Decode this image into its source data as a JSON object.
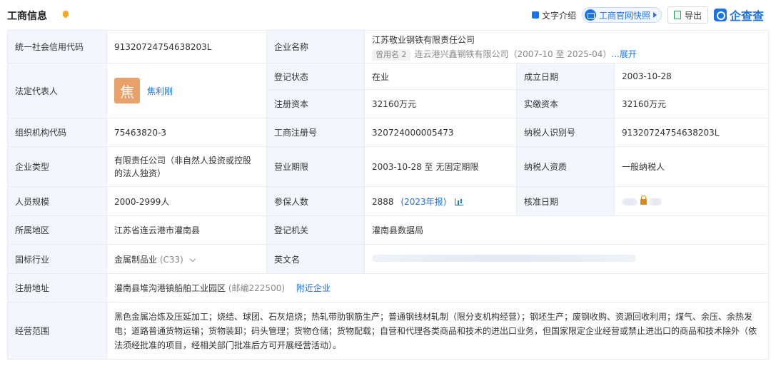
{
  "header": {
    "title": "工商信息",
    "text_intro": "文字介绍",
    "snapshot": "工商官网快照",
    "export": "导出",
    "logo": "企查查"
  },
  "rows": {
    "credit_code_label": "统一社会信用代码",
    "credit_code": "91320724754638203L",
    "company_name_label": "企业名称",
    "company_name": "江苏敬业钢铁有限责任公司",
    "former_tag": "曾用名 2",
    "former_name": "连云港兴鑫钢铁有限公司（2007-10 至 2025-04）",
    "expand": "...展开",
    "legal_label": "法定代表人",
    "legal_avatar": "焦",
    "legal_name": "焦利刚",
    "reg_status_label": "登记状态",
    "reg_status": "在业",
    "founded_label": "成立日期",
    "founded": "2003-10-28",
    "reg_capital_label": "注册资本",
    "reg_capital": "32160万元",
    "paid_capital_label": "实缴资本",
    "paid_capital": "32160万元",
    "org_code_label": "组织机构代码",
    "org_code": "75463820-3",
    "biz_reg_label": "工商注册号",
    "biz_reg": "320724000005473",
    "taxpayer_id_label": "纳税人识别号",
    "taxpayer_id": "91320724754638203L",
    "ent_type_label": "企业类型",
    "ent_type": "有限责任公司（非自然人投资或控股的法人独资）",
    "term_label": "营业期限",
    "term": "2003-10-28 至 无固定期限",
    "tax_qual_label": "纳税人资质",
    "tax_qual": "一般纳税人",
    "staff_label": "人员规模",
    "staff": "2000-2999人",
    "insured_label": "参保人数",
    "insured": "2888",
    "insured_year": "(2023年报)",
    "approve_label": "核准日期",
    "region_label": "所属地区",
    "region": "江苏省连云港市灌南县",
    "authority_label": "登记机关",
    "authority": "灌南县数据局",
    "industry_label": "国标行业",
    "industry": "金属制品业",
    "industry_code": "(C33)",
    "english_label": "英文名",
    "address_label": "注册地址",
    "address": "灌南县堆沟港镇船舶工业园区",
    "postcode": "(邮编222500)",
    "nearby": "附近企业",
    "scope_label": "经营范围",
    "scope": "黑色金属冶炼及压延加工；烧结、球团、石灰焙烧；热轧带肋钢筋生产；普通钢线材轧制（限分支机构经营）；钢坯生产；废钢收购、资源回收利用；煤气、余压、余热发电；道路普通货物运输；货物装卸；码头管理；货物仓储；货物配载；自营和代理各类商品和技术的进出口业务，但国家限定企业经营或禁止进出口的商品和技术除外（依法须经批准的项目，经相关部门批准后方可开展经营活动）。"
  }
}
